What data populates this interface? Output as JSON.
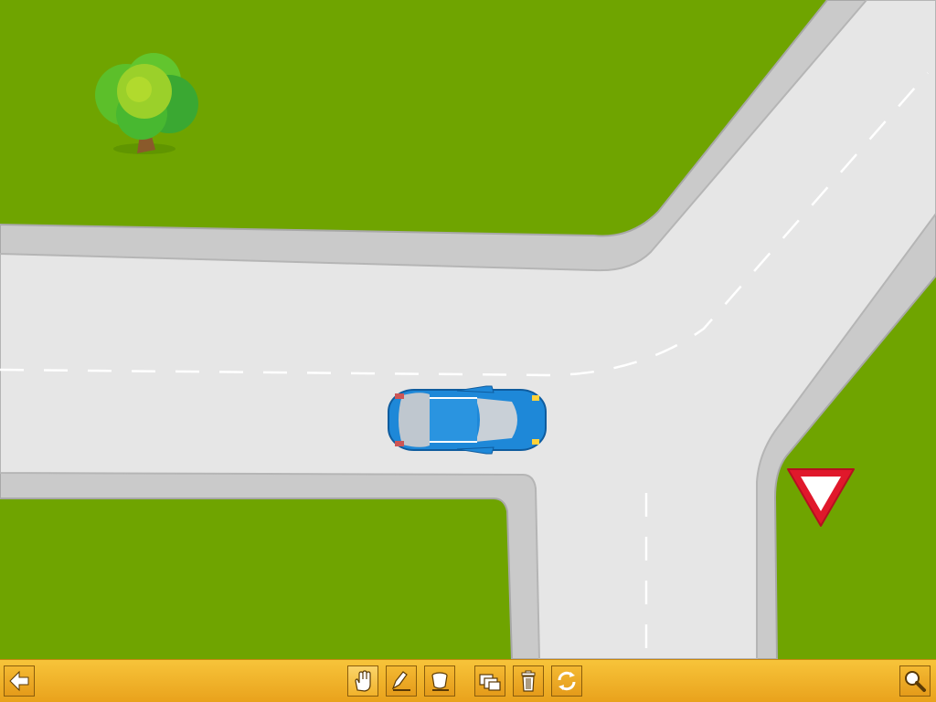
{
  "scene": {
    "colors": {
      "grass": "#6fa400",
      "road": "#e6e6e6",
      "curb": "#c9c9c9",
      "lane_marking": "#ffffff",
      "car_body": "#1e88d8",
      "yield_sign": "#e0182b"
    },
    "objects": [
      {
        "name": "tree",
        "icon": "tree-icon"
      },
      {
        "name": "car",
        "icon": "car-topview-icon"
      },
      {
        "name": "yield-sign",
        "icon": "yield-triangle-icon"
      }
    ]
  },
  "toolbar": {
    "background": "#f3b22b",
    "buttons": [
      {
        "name": "back-button",
        "icon": "arrow-left-icon"
      },
      {
        "name": "hand-tool-button",
        "icon": "hand-icon"
      },
      {
        "name": "pen-tool-button",
        "icon": "pen-icon"
      },
      {
        "name": "bucket-tool-button",
        "icon": "bucket-icon"
      },
      {
        "name": "layers-button",
        "icon": "layers-icon"
      },
      {
        "name": "delete-button",
        "icon": "trash-icon"
      },
      {
        "name": "refresh-button",
        "icon": "refresh-icon"
      },
      {
        "name": "zoom-button",
        "icon": "magnifier-icon"
      }
    ]
  }
}
